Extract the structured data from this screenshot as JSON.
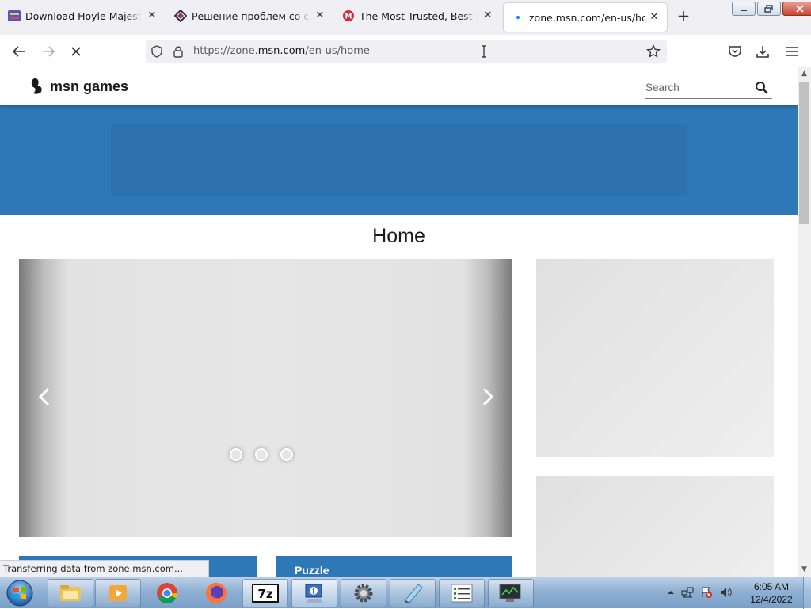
{
  "browser": {
    "tabs": [
      {
        "title": "Download Hoyle Majestic Chess",
        "favicon": "hoyle-favicon-icon",
        "active": false
      },
      {
        "title": "Решение проблем со скачиванием",
        "favicon": "site-favicon-icon",
        "active": false
      },
      {
        "title": "The Most Trusted, Best-Protected",
        "favicon": "mega-favicon-icon",
        "active": false
      },
      {
        "title": "zone.msn.com/en-us/home",
        "favicon": "loading-favicon-icon",
        "active": true
      }
    ],
    "url_prefix": "https://zone.",
    "url_host": "msn.com",
    "url_path": "/en-us/home",
    "status_text": "Transferring data from zone.msn.com..."
  },
  "site": {
    "logo_text": "msn games",
    "search_placeholder": "Search",
    "page_title": "Home",
    "carousel": {
      "slide_count": 3
    },
    "categories": [
      "",
      "Puzzle"
    ],
    "colors": {
      "header_blue": "#2f78b7",
      "text": "#1a1a1a"
    }
  },
  "taskbar": {
    "apps": [
      "explorer-icon",
      "media-player-icon",
      "chrome-icon",
      "firefox-icon",
      "7zip-icon",
      "setup-icon",
      "settings-gear-icon",
      "notepad-icon",
      "task-list-icon",
      "monitor-icon"
    ],
    "tray_icons": [
      "show-hidden-icons-icon",
      "network-icon",
      "action-center-icon",
      "volume-icon"
    ],
    "time": "6:05 AM",
    "date": "12/4/2022"
  }
}
